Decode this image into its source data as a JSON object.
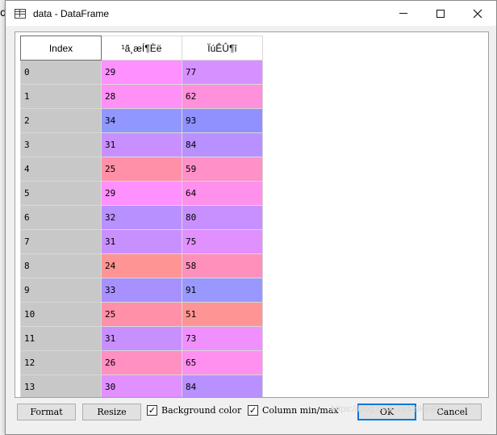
{
  "window": {
    "title": "data - DataFrame",
    "background_leftover_text": "d"
  },
  "table": {
    "headers": [
      "Index",
      "¹ã¸æÍ¶Èë",
      "ÏúÊÛ¶î"
    ],
    "rows": [
      {
        "index": "0",
        "c1": "29",
        "c1_color": "#ff90ff",
        "c2": "77",
        "c2_color": "#d790ff"
      },
      {
        "index": "1",
        "c1": "28",
        "c1_color": "#ff90f5",
        "c2": "62",
        "c2_color": "#ff90dc"
      },
      {
        "index": "2",
        "c1": "34",
        "c1_color": "#9098ff",
        "c2": "93",
        "c2_color": "#9090ff"
      },
      {
        "index": "3",
        "c1": "31",
        "c1_color": "#c890ff",
        "c2": "84",
        "c2_color": "#b890ff"
      },
      {
        "index": "4",
        "c1": "25",
        "c1_color": "#ff90a8",
        "c2": "59",
        "c2_color": "#ff90c8"
      },
      {
        "index": "5",
        "c1": "29",
        "c1_color": "#ff90ff",
        "c2": "64",
        "c2_color": "#ff90ec"
      },
      {
        "index": "6",
        "c1": "32",
        "c1_color": "#b890ff",
        "c2": "80",
        "c2_color": "#c890ff"
      },
      {
        "index": "7",
        "c1": "31",
        "c1_color": "#c890ff",
        "c2": "75",
        "c2_color": "#e090ff"
      },
      {
        "index": "8",
        "c1": "24",
        "c1_color": "#ff9494",
        "c2": "58",
        "c2_color": "#ff90bc"
      },
      {
        "index": "9",
        "c1": "33",
        "c1_color": "#a890ff",
        "c2": "91",
        "c2_color": "#9898ff"
      },
      {
        "index": "10",
        "c1": "25",
        "c1_color": "#ff90a8",
        "c2": "51",
        "c2_color": "#ff9494"
      },
      {
        "index": "11",
        "c1": "31",
        "c1_color": "#c890ff",
        "c2": "73",
        "c2_color": "#f090ff"
      },
      {
        "index": "12",
        "c1": "26",
        "c1_color": "#ff90c0",
        "c2": "65",
        "c2_color": "#ff90f0"
      },
      {
        "index": "13",
        "c1": "30",
        "c1_color": "#e090ff",
        "c2": "84",
        "c2_color": "#b890ff"
      }
    ]
  },
  "footer": {
    "format_label": "Format",
    "resize_label": "Resize",
    "background_color_label": "Background color",
    "background_color_checked": true,
    "column_minmax_label": "Column min/max",
    "column_minmax_checked": true,
    "ok_label": "OK",
    "cancel_label": "Cancel",
    "watermark": "https://blog.csdn.net/allen63"
  }
}
